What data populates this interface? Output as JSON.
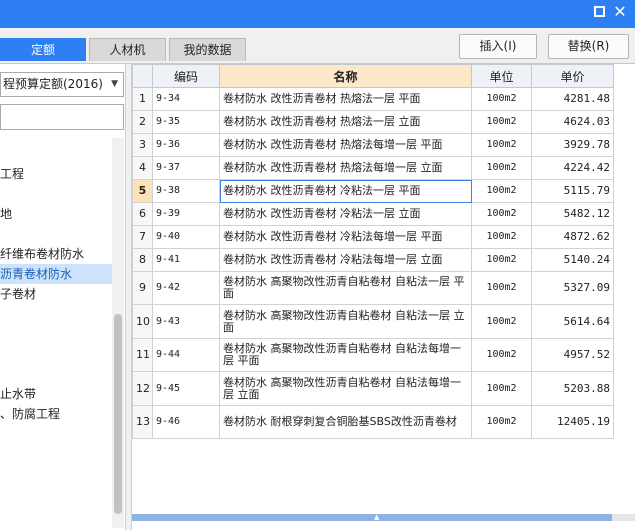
{
  "window": {
    "maximize_icon": "maximize-icon",
    "close_icon": "close-icon",
    "close_glyph": "✕",
    "accent": "#2d7ff2"
  },
  "tabs": [
    {
      "label": "定额",
      "active": true
    },
    {
      "label": "人材机",
      "active": false
    },
    {
      "label": "我的数据",
      "active": false
    }
  ],
  "toolbar": {
    "insert_label": "插入(I)",
    "replace_label": "替换(R)"
  },
  "left": {
    "quota_select_value": "程预算定额(2016)",
    "search_placeholder": "",
    "tree": [
      {
        "label": "工程",
        "selected": false
      },
      {
        "label": "地",
        "selected": false
      },
      {
        "label": "",
        "selected": false
      },
      {
        "label": "纤维布卷材防水",
        "selected": false
      },
      {
        "label": "沥青卷材防水",
        "selected": true
      },
      {
        "label": "子卷材",
        "selected": false
      },
      {
        "label": "",
        "selected": false
      },
      {
        "label": "",
        "selected": false
      },
      {
        "label": "",
        "selected": false
      },
      {
        "label": "",
        "selected": false
      },
      {
        "label": "止水带",
        "selected": false
      },
      {
        "label": "、防腐工程",
        "selected": false
      }
    ]
  },
  "grid": {
    "headers": {
      "code": "编码",
      "name": "名称",
      "unit": "单位",
      "price": "单价"
    },
    "current_row": 5,
    "rows": [
      {
        "num": "1",
        "code": "9-34",
        "name": "卷材防水 改性沥青卷材 热熔法一层 平面",
        "unit": "100m2",
        "price": "4281.48"
      },
      {
        "num": "2",
        "code": "9-35",
        "name": "卷材防水 改性沥青卷材 热熔法一层 立面",
        "unit": "100m2",
        "price": "4624.03"
      },
      {
        "num": "3",
        "code": "9-36",
        "name": "卷材防水 改性沥青卷材 热熔法每增一层 平面",
        "unit": "100m2",
        "price": "3929.78"
      },
      {
        "num": "4",
        "code": "9-37",
        "name": "卷材防水 改性沥青卷材 热熔法每增一层 立面",
        "unit": "100m2",
        "price": "4224.42"
      },
      {
        "num": "5",
        "code": "9-38",
        "name": "卷材防水 改性沥青卷材 冷粘法一层 平面",
        "unit": "100m2",
        "price": "5115.79"
      },
      {
        "num": "6",
        "code": "9-39",
        "name": "卷材防水 改性沥青卷材 冷粘法一层 立面",
        "unit": "100m2",
        "price": "5482.12"
      },
      {
        "num": "7",
        "code": "9-40",
        "name": "卷材防水 改性沥青卷材 冷粘法每增一层 平面",
        "unit": "100m2",
        "price": "4872.62"
      },
      {
        "num": "8",
        "code": "9-41",
        "name": "卷材防水 改性沥青卷材 冷粘法每增一层 立面",
        "unit": "100m2",
        "price": "5140.24"
      },
      {
        "num": "9",
        "code": "9-42",
        "name": "卷材防水 高聚物改性沥青自粘卷材 自粘法一层 平面",
        "unit": "100m2",
        "price": "5327.09"
      },
      {
        "num": "10",
        "code": "9-43",
        "name": "卷材防水 高聚物改性沥青自粘卷材 自粘法一层 立面",
        "unit": "100m2",
        "price": "5614.64"
      },
      {
        "num": "11",
        "code": "9-44",
        "name": "卷材防水 高聚物改性沥青自粘卷材 自粘法每增一层 平面",
        "unit": "100m2",
        "price": "4957.52"
      },
      {
        "num": "12",
        "code": "9-45",
        "name": "卷材防水 高聚物改性沥青自粘卷材 自粘法每增一层 立面",
        "unit": "100m2",
        "price": "5203.88"
      },
      {
        "num": "13",
        "code": "9-46",
        "name": "卷材防水 耐根穿刺复合铜胎基SBS改性沥青卷材",
        "unit": "100m2",
        "price": "12405.19"
      }
    ]
  }
}
